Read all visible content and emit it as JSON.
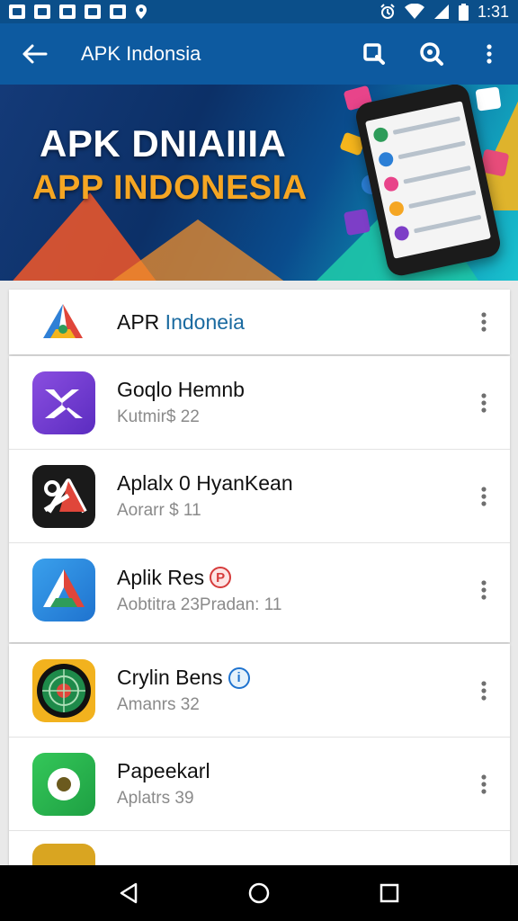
{
  "status_bar": {
    "time": "1:31",
    "icons": [
      "notification-icon",
      "photo-icon",
      "download-icon",
      "sync-icon",
      "location-icon",
      "alarm-icon",
      "wifi-icon",
      "signal-icon",
      "battery-icon"
    ]
  },
  "app_bar": {
    "title": "APK Indonsia",
    "icons": [
      "back-arrow-icon",
      "search-icon",
      "search-zoom-icon",
      "more-vert-icon"
    ]
  },
  "banner": {
    "line1": "APK DNIAIIIA",
    "line2": "APP INDONESIA"
  },
  "header_item": {
    "name_part1": "APR",
    "name_part2": " Indoneia"
  },
  "apps": [
    {
      "title": "Goqlo Hemnb",
      "subtitle": "Kutmir$ 22",
      "icon": "purple-app-icon",
      "badge": ""
    },
    {
      "title": "Aplalx 0 HyanKean",
      "subtitle": "Aorarr $ 11",
      "icon": "black-app-icon",
      "badge": ""
    },
    {
      "title": "Aplik Res",
      "subtitle": "Aobtitra 23Pradan: 11",
      "icon": "blue-triangle-app-icon",
      "badge": "P"
    },
    {
      "title": "Crylin Bens",
      "subtitle": "Amanrs 32",
      "icon": "radar-app-icon",
      "badge": "i"
    },
    {
      "title": "Papeekarl",
      "subtitle": "Aplatrs 39",
      "icon": "green-dot-app-icon",
      "badge": ""
    }
  ],
  "colors": {
    "status_bar": "#0b4f8a",
    "app_bar": "#0d5aa0",
    "banner_accent": "#f5a623"
  }
}
